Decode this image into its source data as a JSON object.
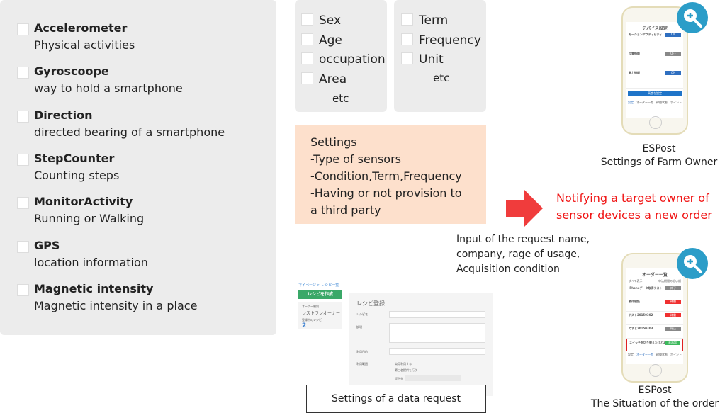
{
  "sensors": [
    {
      "title": "Accelerometer",
      "desc": "Physical activities"
    },
    {
      "title": "Gyroscoope",
      "desc": "way to hold a smartphone"
    },
    {
      "title": "Direction",
      "desc": "directed bearing of a smartphone"
    },
    {
      "title": "StepCounter",
      "desc": "Counting steps"
    },
    {
      "title": "MonitorActivity",
      "desc": "Running or Walking"
    },
    {
      "title": "GPS",
      "desc": "location information"
    },
    {
      "title": "Magnetic intensity",
      "desc": "Magnetic intensity in a place"
    }
  ],
  "attributes": {
    "items": [
      "Sex",
      "Age",
      "occupation",
      "Area"
    ],
    "etc": "etc"
  },
  "conditions": {
    "items": [
      "Term",
      "Frequency",
      "Unit"
    ],
    "etc": "etc"
  },
  "settings": {
    "lines": [
      "Settings",
      "-Type of sensors",
      "-Condition,Term,Frequency",
      "-Having or not provision to",
      "a third party"
    ]
  },
  "notify": {
    "lines": [
      "Notifying a target owner of",
      "sensor devices a new order"
    ],
    "color": "#f01414"
  },
  "input_note": {
    "lines": [
      "Input of the request name,",
      "company, rage of usage,",
      "Acquisition condition"
    ]
  },
  "request_screen": {
    "breadcrumb": "マイページ > レシピ一覧",
    "create_button": "レシピを作成",
    "owner_label": "オーナー種別",
    "owner_value": "レストランオーナー",
    "count_label": "登録中のレシピ",
    "count_value": "2",
    "form_title": "レシピ登録",
    "fields": [
      "レシピ名",
      "説明",
      "利用目的",
      "利用範囲"
    ],
    "options": [
      "商用利用する",
      "第三者提供を行う"
    ],
    "provider_label": "提供先",
    "caption": "Settings of a data request"
  },
  "phone_settings": {
    "title": "デバイス設定",
    "items": [
      {
        "label": "モーションアクティビティ",
        "state": "ON"
      },
      {
        "label": "位置情報",
        "state": "OFF"
      },
      {
        "label": "磁力情報",
        "state": "ON"
      }
    ],
    "button": "高度な設定",
    "tabs": [
      "設定",
      "オーダー一覧",
      "稼働状態",
      "ポイント"
    ],
    "caption": [
      "ESPost",
      "Settings of Farm Owner"
    ]
  },
  "phone_orders": {
    "title": "オーダー一覧",
    "filter_left": "すべて表示",
    "filter_right": "申込期間の近い順",
    "orders": [
      {
        "name": "iPhoneデータ取得テスト",
        "status": "終了",
        "color": "#888888"
      },
      {
        "name": "動作検証",
        "status": "稼働",
        "color": "#f03030"
      },
      {
        "name": "テスト20150302",
        "status": "稼働",
        "color": "#f03030"
      },
      {
        "name": "てすと20150303",
        "status": "停止",
        "color": "#888888"
      },
      {
        "name": "スイッチを切り替えたけど2",
        "status": "未承認",
        "color": "#3cb85c"
      }
    ],
    "tabs": [
      "設定",
      "オーダー一覧",
      "稼働状態",
      "ポイント"
    ],
    "caption": [
      "ESPost",
      "The Situation of the order"
    ]
  },
  "colors": {
    "panel": "#ececec",
    "settings_bg": "#fde0cc",
    "arrow": "#f03c3c",
    "zoom": "#2b9dc8",
    "green": "#3aa868"
  }
}
